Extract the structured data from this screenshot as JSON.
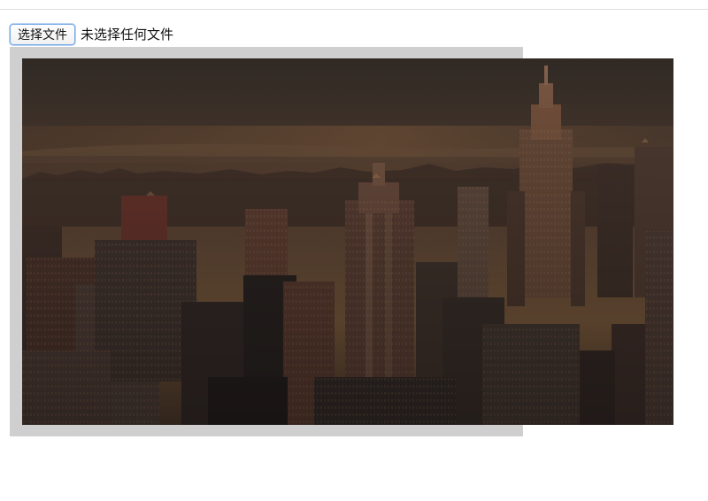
{
  "file_input": {
    "button_label": "选择文件",
    "status_text": "未选择任何文件"
  },
  "image": {
    "subject": "city-skyline-photo",
    "description_icon": "photo-icon"
  },
  "colors": {
    "frame_gray": "#cfcfcf",
    "focus_blue": "#74a7e6",
    "sky_top": "#3e352d",
    "sky_horizon": "#8d6a45",
    "building_dark": "#24201d",
    "building_warm": "#6c5140"
  }
}
